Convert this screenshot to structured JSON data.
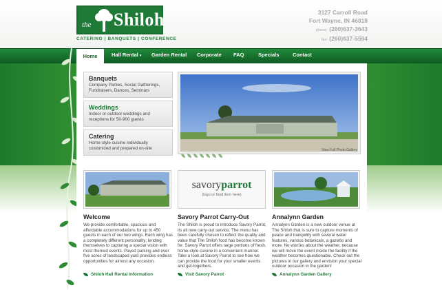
{
  "brand": {
    "prefix": "the",
    "name": "Shiloh",
    "tagline": "CATERING | BANQUETS | CONFERENCE"
  },
  "contact": {
    "address1": "3127 Carroll Road",
    "address2": "Fort Wayne, IN 46818",
    "phone_label": "phone:",
    "phone": "(260)637-3643",
    "fax_label": "fax:",
    "fax": "(260)637-5594"
  },
  "nav": {
    "home": "Home",
    "hall_rental": "Hall Rental",
    "garden_rental": "Garden Rental",
    "corporate": "Corporate",
    "faq": "FAQ",
    "specials": "Specials",
    "contact": "Contact"
  },
  "services": [
    {
      "title": "Banquets",
      "desc": "Company Parties, Social Gatherings, Fundraisers, Dances, Seminars"
    },
    {
      "title": "Weddings",
      "desc": "Indoor or outdoor weddings and receptions for 50-900 guests"
    },
    {
      "title": "Catering",
      "desc": "Home-style cuisine individually customized and prepared on-site"
    }
  ],
  "hero": {
    "gallery_link": "View Full Photo Gallery"
  },
  "columns": {
    "welcome": {
      "title": "Welcome",
      "body": "We provide comfortable, spacious and affordable accommodations for up to 450 guests in each of our two wings. Each wing has a completely different personality; lending themselves to capturing a special vision with most themed events. Paved parking and over five acres of landscaped yard provides endless opportunities for almost any occasion.",
      "link": "Shiloh Hall Rental Information"
    },
    "savory": {
      "logo_a": "savory",
      "logo_b": "parrot",
      "logo_note": "(logo or food item here)",
      "title": "Savory Parrot Carry-Out",
      "body": "The Shiloh is proud to introduce Savory Parrot, its all new carry-out service. The menu has been carefully chosen to reflect the quality and value that The Shiloh food has become known for. Savory Parrot offers large portions of fresh, home-style cuisine in a convenient manner. Take a look at Savory Parrot to see how we can provide the food for your smaller events and get-togethers.",
      "link": "Visit Savory Parrot"
    },
    "garden": {
      "title": "Annalynn Garden",
      "body": "Annalynn Garden is a new outdoor venue at The Shiloh that is sure to capture moments of peace and tranquility with several water features, various botanicals, a gazebo and more. No worries about the weather, because we will move the event inside the facility if the weather becomes questionable. Check out the pictures in our gallery and envision your special outdoor occasion in the garden!",
      "link": "Annalynn Garden Gallery"
    }
  },
  "colors": {
    "brand_green": "#1f7a37",
    "nav_green": "#1f8a3a"
  }
}
